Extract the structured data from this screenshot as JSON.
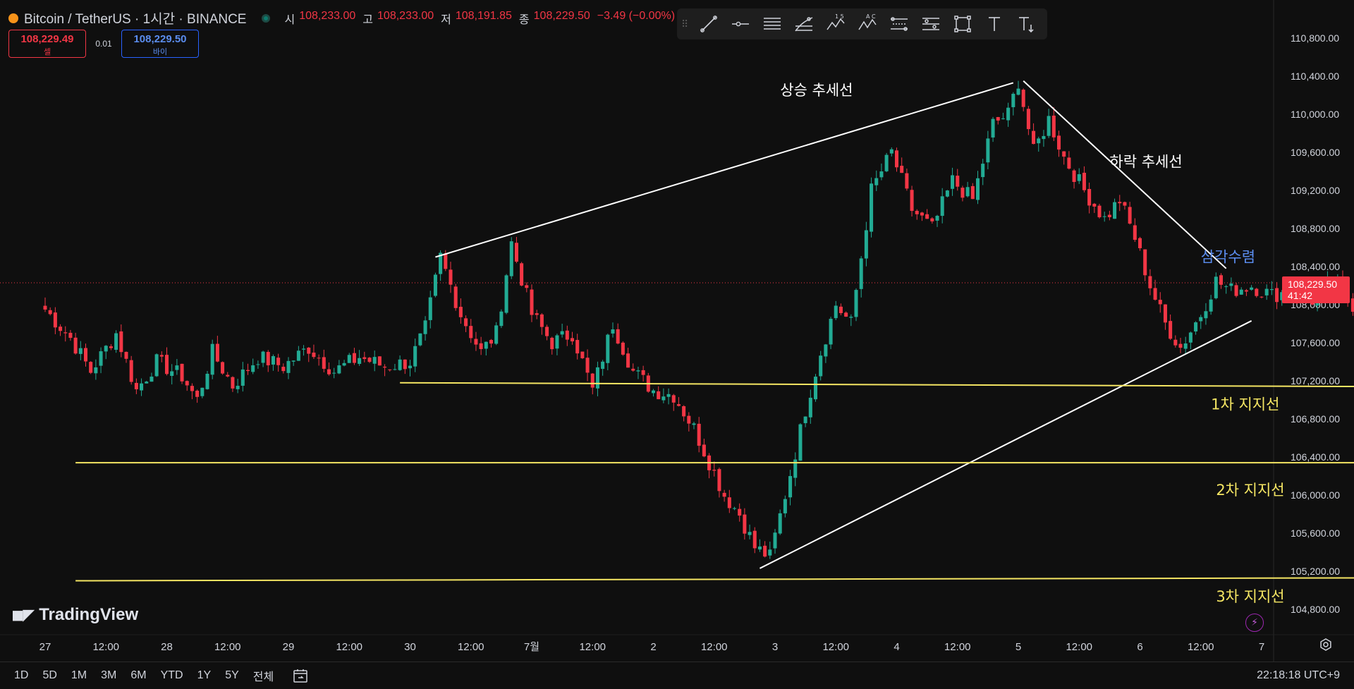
{
  "header": {
    "symbol": "Bitcoin / TetherUS · 1시간 · BINANCE",
    "ohlc": [
      {
        "label": "시",
        "value": "108,233.00"
      },
      {
        "label": "고",
        "value": "108,233.00"
      },
      {
        "label": "저",
        "value": "108,191.85"
      },
      {
        "label": "종",
        "value": "108,229.50"
      }
    ],
    "change": "−3.49 (−0.00%)"
  },
  "trade": {
    "sell_price": "108,229.49",
    "sell_label": "셀",
    "spread": "0.01",
    "buy_price": "108,229.50",
    "buy_label": "바이"
  },
  "toolbar": {
    "icons": [
      "trend-line-icon",
      "horizontal-ray-icon",
      "parallel-channel-icon",
      "fib-retracement-icon",
      "elliott-wave-icon",
      "abcd-pattern-icon",
      "date-range-icon",
      "price-range-icon",
      "rectangle-icon",
      "text-icon",
      "text-anchor-icon"
    ],
    "label_15": "1 5",
    "label_ac": "A C"
  },
  "price_tag": {
    "price": "108,229.50",
    "countdown": "41:42"
  },
  "branding": {
    "logo_text": "TradingView"
  },
  "bottom_bar": {
    "ranges": [
      "1D",
      "5D",
      "1M",
      "3M",
      "6M",
      "YTD",
      "1Y",
      "5Y",
      "전체"
    ],
    "clock": "22:18:18 UTC+9"
  },
  "colors": {
    "background": "#0f0f0f",
    "up": "#22ab94",
    "down": "#f23645",
    "trend_line": "#ffffff",
    "support_line": "#f5e663",
    "triangle_label": "#5b8def"
  },
  "chart_data": {
    "type": "candlestick",
    "symbol": "BTCUSDT",
    "interval": "1h",
    "ylim": [
      104600,
      111200
    ],
    "y_ticks": [
      "110,800.00",
      "110,400.00",
      "110,000.00",
      "109,600.00",
      "109,200.00",
      "108,800.00",
      "108,400.00",
      "108,000.00",
      "107,600.00",
      "107,200.00",
      "106,800.00",
      "106,400.00",
      "106,000.00",
      "105,600.00",
      "105,200.00",
      "104,800.00"
    ],
    "y_tick_values": [
      110800,
      110400,
      110000,
      109600,
      109200,
      108800,
      108400,
      108000,
      107600,
      107200,
      106800,
      106400,
      106000,
      105600,
      105200,
      104800
    ],
    "x_ticks": [
      "27",
      "12:00",
      "28",
      "12:00",
      "29",
      "12:00",
      "30",
      "12:00",
      "7월",
      "12:00",
      "2",
      "12:00",
      "3",
      "12:00",
      "4",
      "12:00",
      "5",
      "12:00",
      "6",
      "12:00",
      "7"
    ],
    "x_tick_hours": [
      0,
      12,
      24,
      36,
      48,
      60,
      72,
      84,
      96,
      108,
      120,
      132,
      144,
      156,
      168,
      180,
      192,
      204,
      216,
      228,
      240
    ],
    "last_price": 108229.5,
    "anchors": [
      [
        0,
        107950
      ],
      [
        5,
        107650
      ],
      [
        9,
        107300
      ],
      [
        14,
        107700
      ],
      [
        18,
        107100
      ],
      [
        22,
        107400
      ],
      [
        27,
        107250
      ],
      [
        30,
        107000
      ],
      [
        33,
        107500
      ],
      [
        37,
        107150
      ],
      [
        42,
        107450
      ],
      [
        47,
        107350
      ],
      [
        52,
        107550
      ],
      [
        57,
        107300
      ],
      [
        62,
        107450
      ],
      [
        67,
        107350
      ],
      [
        72,
        107400
      ],
      [
        75,
        107750
      ],
      [
        78,
        108500
      ],
      [
        82,
        107900
      ],
      [
        86,
        107500
      ],
      [
        89,
        107700
      ],
      [
        92,
        108650
      ],
      [
        96,
        107900
      ],
      [
        100,
        107600
      ],
      [
        104,
        107700
      ],
      [
        108,
        107100
      ],
      [
        112,
        107800
      ],
      [
        116,
        107300
      ],
      [
        120,
        107100
      ],
      [
        124,
        107050
      ],
      [
        128,
        106700
      ],
      [
        131,
        106350
      ],
      [
        134,
        106000
      ],
      [
        137,
        105800
      ],
      [
        140,
        105450
      ],
      [
        143,
        105350
      ],
      [
        146,
        106000
      ],
      [
        150,
        106900
      ],
      [
        153,
        107500
      ],
      [
        156,
        108000
      ],
      [
        159,
        107800
      ],
      [
        163,
        109200
      ],
      [
        167,
        109600
      ],
      [
        171,
        109000
      ],
      [
        175,
        108800
      ],
      [
        179,
        109300
      ],
      [
        183,
        109100
      ],
      [
        187,
        109900
      ],
      [
        190,
        110000
      ],
      [
        192,
        110350
      ],
      [
        195,
        109600
      ],
      [
        198,
        109950
      ],
      [
        201,
        109550
      ],
      [
        205,
        109200
      ],
      [
        209,
        108900
      ],
      [
        212,
        109100
      ],
      [
        215,
        108700
      ],
      [
        218,
        108200
      ],
      [
        221,
        107800
      ],
      [
        224,
        107550
      ],
      [
        228,
        107900
      ],
      [
        231,
        108250
      ],
      [
        234,
        108150
      ],
      [
        238,
        108200
      ],
      [
        242,
        108100
      ],
      [
        246,
        108150
      ],
      [
        250,
        108050
      ],
      [
        254,
        108250
      ],
      [
        258,
        108000
      ],
      [
        262,
        108230
      ]
    ],
    "series": [
      {
        "name": "상승 추세선",
        "type": "trendline",
        "from": {
          "hour": 77,
          "price": 108500
        },
        "to": {
          "hour": 191,
          "price": 110330
        }
      },
      {
        "name": "하락 추세선",
        "type": "trendline",
        "from": {
          "hour": 193,
          "price": 110350
        },
        "to": {
          "hour": 233,
          "price": 108380
        }
      },
      {
        "name": "삼각수렴",
        "type": "trendline",
        "from": {
          "hour": 141,
          "price": 105230
        },
        "to": {
          "hour": 238,
          "price": 107830
        }
      },
      {
        "name": "1차 지지선",
        "type": "support",
        "from": {
          "hour": 70,
          "price": 107180
        },
        "to": {
          "hour": 260,
          "price": 107140
        }
      },
      {
        "name": "2차 지지선",
        "type": "support",
        "from": {
          "hour": 6,
          "price": 106340
        },
        "to": {
          "hour": 260,
          "price": 106340
        }
      },
      {
        "name": "3차 지지선",
        "type": "support",
        "from": {
          "hour": 6,
          "price": 105100
        },
        "to": {
          "hour": 260,
          "price": 105130
        }
      }
    ],
    "labels": [
      {
        "text": "상승 추세선",
        "hour": 145,
        "price": 110200
      },
      {
        "text": "하락 추세선",
        "hour": 210,
        "price": 109450
      },
      {
        "text": "삼각수렴",
        "hour": 228,
        "price": 108450
      },
      {
        "text": "1차 지지선",
        "hour": 230,
        "price": 106900
      },
      {
        "text": "2차 지지선",
        "hour": 231,
        "price": 106000
      },
      {
        "text": "3차 지지선",
        "hour": 231,
        "price": 104880
      }
    ]
  }
}
